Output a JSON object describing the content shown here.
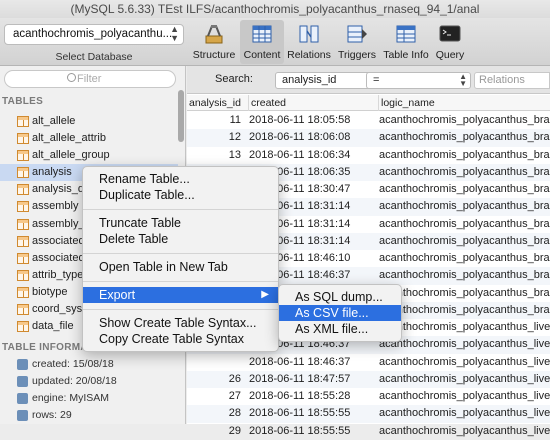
{
  "window": {
    "title": "(MySQL 5.6.33) TEst ILFS/acanthochromis_polyacanthus_rnaseq_94_1/anal"
  },
  "toolbar": {
    "database_value": "acanthochromis_polyacanthu...",
    "database_label": "Select Database",
    "buttons": [
      {
        "label": "Structure",
        "icon": "structure-icon"
      },
      {
        "label": "Content",
        "icon": "content-icon",
        "active": true
      },
      {
        "label": "Relations",
        "icon": "relations-icon"
      },
      {
        "label": "Triggers",
        "icon": "triggers-icon"
      },
      {
        "label": "Table Info",
        "icon": "table-info-icon"
      },
      {
        "label": "Query",
        "icon": "query-icon"
      }
    ]
  },
  "sidebar": {
    "filter_placeholder": "Filter",
    "tables_heading": "TABLES",
    "tables": [
      "alt_allele",
      "alt_allele_attrib",
      "alt_allele_group",
      "analysis",
      "analysis_de",
      "assembly",
      "assembly_e",
      "associated",
      "associated",
      "attrib_type",
      "biotype",
      "coord_syst",
      "data_file"
    ],
    "selected_table": "analysis",
    "info_heading": "TABLE INFORMAT",
    "info": [
      "created: 15/08/18",
      "updated: 20/08/18",
      "engine: MyISAM",
      "rows: 29"
    ]
  },
  "search": {
    "label": "Search:",
    "field": "analysis_id",
    "operator": "=",
    "value_placeholder": "Relations"
  },
  "grid": {
    "columns": [
      "analysis_id",
      "created",
      "logic_name"
    ],
    "rows": [
      [
        "11",
        "2018-06-11 18:05:58",
        "acanthochromis_polyacanthus_bra..."
      ],
      [
        "12",
        "2018-06-11 18:06:08",
        "acanthochromis_polyacanthus_bra..."
      ],
      [
        "13",
        "2018-06-11 18:06:34",
        "acanthochromis_polyacanthus_bra..."
      ],
      [
        "",
        "2018-06-11 18:06:35",
        "acanthochromis_polyacanthus_bra..."
      ],
      [
        "",
        "2018-06-11 18:30:47",
        "acanthochromis_polyacanthus_bra..."
      ],
      [
        "",
        "2018-06-11 18:31:14",
        "acanthochromis_polyacanthus_bra..."
      ],
      [
        "",
        "2018-06-11 18:31:14",
        "acanthochromis_polyacanthus_bra..."
      ],
      [
        "",
        "2018-06-11 18:31:14",
        "acanthochromis_polyacanthus_bra..."
      ],
      [
        "",
        "2018-06-11 18:46:10",
        "acanthochromis_polyacanthus_bra..."
      ],
      [
        "",
        "2018-06-11 18:46:37",
        "acanthochromis_polyacanthus_bra..."
      ],
      [
        "",
        "2018-06-11 18:46:37",
        "acanthochromis_polyacanthus_bra..."
      ],
      [
        "",
        "2018-06-11 18:46:37",
        "acanthochromis_polyacanthus_bra..."
      ],
      [
        "",
        "2018-06-11 18:46:37",
        "acanthochromis_polyacanthus_live..."
      ],
      [
        "",
        "2018-06-11 18:46:37",
        "acanthochromis_polyacanthus_live..."
      ],
      [
        "",
        "2018-06-11 18:46:37",
        "acanthochromis_polyacanthus_live..."
      ],
      [
        "26",
        "2018-06-11 18:47:57",
        "acanthochromis_polyacanthus_live..."
      ],
      [
        "27",
        "2018-06-11 18:55:28",
        "acanthochromis_polyacanthus_live..."
      ],
      [
        "28",
        "2018-06-11 18:55:55",
        "acanthochromis_polyacanthus_live..."
      ],
      [
        "29",
        "2018-06-11 18:55:55",
        "acanthochromis_polyacanthus_live..."
      ]
    ]
  },
  "context_menu": {
    "items": [
      "Rename Table...",
      "Duplicate Table...",
      "Truncate Table",
      "Delete Table",
      "Open Table in New Tab",
      "Export",
      "Show Create Table Syntax...",
      "Copy Create Table Syntax"
    ],
    "highlighted": "Export"
  },
  "export_submenu": {
    "items": [
      "As SQL dump...",
      "As CSV file...",
      "As XML file..."
    ],
    "highlighted": "As CSV file..."
  },
  "colors": {
    "selection": "#2c6fe0",
    "row_selected": "#c9d9f2",
    "table_icon": "#d08a30"
  }
}
